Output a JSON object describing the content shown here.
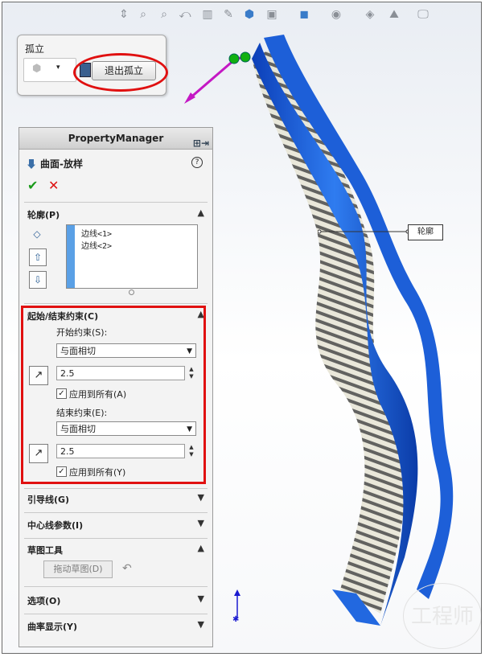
{
  "toolbar": {
    "icons": [
      "view-orientation-icon",
      "zoom-to-fit-icon",
      "zoom-area-icon",
      "previous-view-icon",
      "section-view-icon",
      "view-palette-icon",
      "display-style-icon",
      "hide-show-icon",
      "edit-appearance-icon",
      "apply-scene-icon",
      "view-settings-icon"
    ]
  },
  "isolate_panel": {
    "title": "孤立",
    "exit_label": "退出孤立"
  },
  "property_manager": {
    "header": "PropertyManager",
    "feature_title": "曲面-放样",
    "help": "?",
    "ok": "✔",
    "cancel": "✕",
    "profiles": {
      "title": "轮廓(P)",
      "items": [
        "边线<1>",
        "边线<2>"
      ]
    },
    "constraints": {
      "title": "起始/结束约束(C)",
      "start_label": "开始约束(S):",
      "start_value": "与面相切",
      "start_number": "2.5",
      "start_apply_all": "应用到所有(A)",
      "end_label": "结束约束(E):",
      "end_value": "与面相切",
      "end_number": "2.5",
      "end_apply_all": "应用到所有(Y)"
    },
    "guides": "引导线(G)",
    "centerline": "中心线参数(I)",
    "sketch_tools": {
      "title": "草图工具",
      "drag_label": "拖动草图(D)"
    },
    "options": "选项(O)",
    "curvature": "曲率显示(Y)"
  },
  "canvas": {
    "callout_label": "轮廓",
    "watermark": "工程师",
    "accent": "#1e63e0",
    "highlight_red": "#e01010"
  }
}
